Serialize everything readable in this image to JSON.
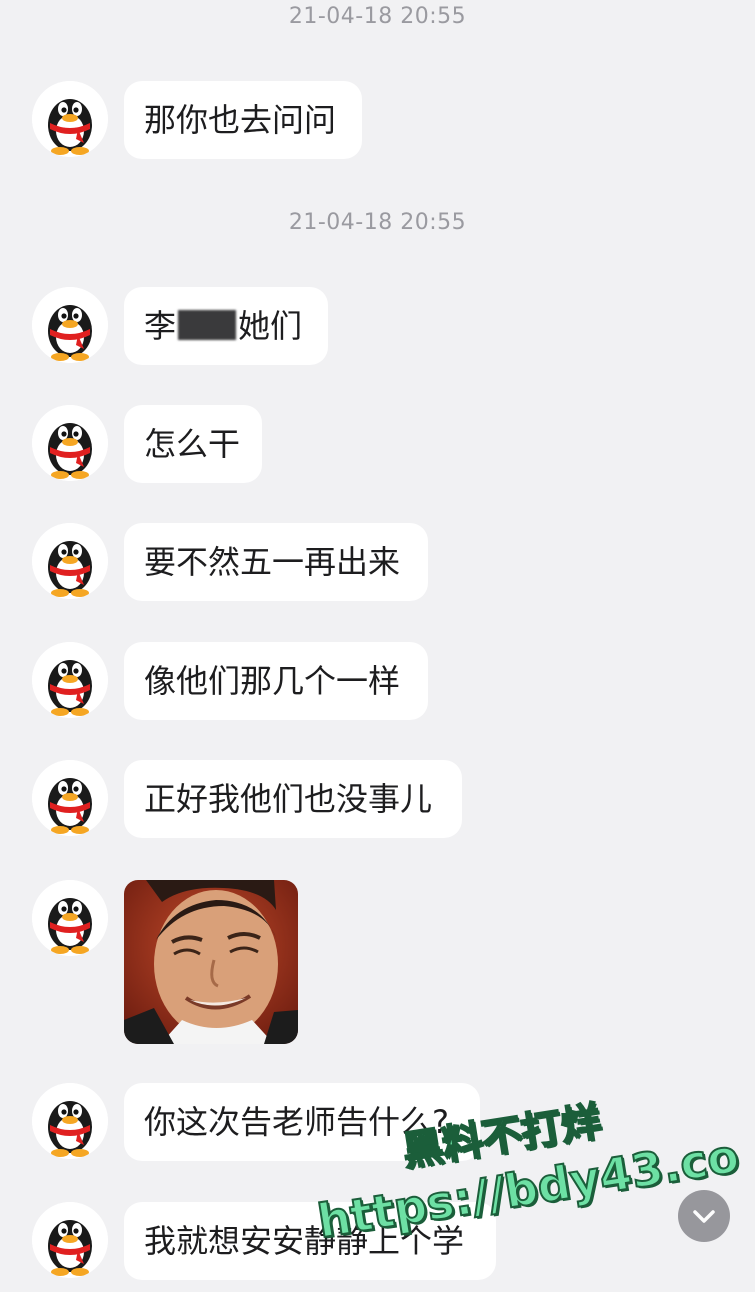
{
  "timestamps": [
    "21-04-18 20:55",
    "21-04-18 20:55"
  ],
  "messages": [
    {
      "type": "text",
      "text": "那你也去问问"
    },
    {
      "type": "text",
      "prefix": "李",
      "suffix": "她们"
    },
    {
      "type": "text",
      "text": "怎么干"
    },
    {
      "type": "text",
      "text": "要不然五一再出来"
    },
    {
      "type": "text",
      "text": "像他们那几个一样"
    },
    {
      "type": "text",
      "text": "正好我他们也没事儿"
    },
    {
      "type": "sticker",
      "description": "smiling-man-sticker"
    },
    {
      "type": "text",
      "text": "你这次告老师告什么?"
    },
    {
      "type": "text",
      "text": "我就想安安静静上个学"
    }
  ],
  "watermark": {
    "cn": "黑料不打烊",
    "url": "https://bdy43.co"
  },
  "icons": {
    "avatar": "qq-penguin-avatar",
    "scroll": "chevron-down-icon"
  },
  "colors": {
    "background": "#f1f1f3",
    "bubble": "#ffffff",
    "timestamp": "#9a9aa0",
    "watermark_fill": "#6de0a4",
    "watermark_stroke": "#1b5e3a"
  }
}
